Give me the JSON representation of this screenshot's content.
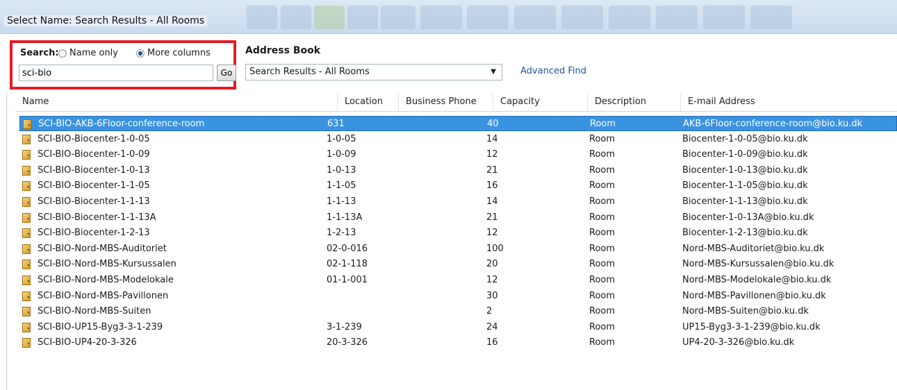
{
  "window": {
    "title": "Select Name: Search Results - All Rooms"
  },
  "search": {
    "label": "Search:",
    "option_name_only": "Name only",
    "option_more_columns": "More columns",
    "selected_option": "More columns",
    "query": "sci-bio",
    "go_label": "Go"
  },
  "address_book": {
    "label": "Address Book",
    "selected": "Search Results - All Rooms",
    "advanced_find": "Advanced Find"
  },
  "table": {
    "columns": [
      "Name",
      "Location",
      "Business Phone",
      "Capacity",
      "Description",
      "E-mail Address"
    ],
    "rows": [
      {
        "name": "SCI-BIO-AKB-6Floor-conference-room",
        "location": "631",
        "phone": "",
        "capacity": "40",
        "description": "Room",
        "email": "AKB-6Floor-conference-room@bio.ku.dk",
        "selected": true
      },
      {
        "name": "SCI-BIO-Biocenter-1-0-05",
        "location": "1-0-05",
        "phone": "",
        "capacity": "14",
        "description": "Room",
        "email": "Biocenter-1-0-05@bio.ku.dk"
      },
      {
        "name": "SCI-BIO-Biocenter-1-0-09",
        "location": "1-0-09",
        "phone": "",
        "capacity": "12",
        "description": "Room",
        "email": "Biocenter-1-0-09@bio.ku.dk"
      },
      {
        "name": "SCI-BIO-Biocenter-1-0-13",
        "location": "1-0-13",
        "phone": "",
        "capacity": "21",
        "description": "Room",
        "email": "Biocenter-1-0-13@bio.ku.dk"
      },
      {
        "name": "SCI-BIO-Biocenter-1-1-05",
        "location": "1-1-05",
        "phone": "",
        "capacity": "16",
        "description": "Room",
        "email": "Biocenter-1-1-05@bio.ku.dk"
      },
      {
        "name": "SCI-BIO-Biocenter-1-1-13",
        "location": "1-1-13",
        "phone": "",
        "capacity": "14",
        "description": "Room",
        "email": "Biocenter-1-1-13@bio.ku.dk"
      },
      {
        "name": "SCI-BIO-Biocenter-1-1-13A",
        "location": "1-1-13A",
        "phone": "",
        "capacity": "21",
        "description": "Room",
        "email": "Biocenter-1-0-13A@bio.ku.dk"
      },
      {
        "name": "SCI-BIO-Biocenter-1-2-13",
        "location": "1-2-13",
        "phone": "",
        "capacity": "12",
        "description": "Room",
        "email": "Biocenter-1-2-13@bio.ku.dk"
      },
      {
        "name": "SCI-BIO-Nord-MBS-Auditoriet",
        "location": "02-0-016",
        "phone": "",
        "capacity": "100",
        "description": "Room",
        "email": "Nord-MBS-Auditoriet@bio.ku.dk"
      },
      {
        "name": "SCI-BIO-Nord-MBS-Kursussalen",
        "location": "02-1-118",
        "phone": "",
        "capacity": "20",
        "description": "Room",
        "email": "Nord-MBS-Kursussalen@bio.ku.dk"
      },
      {
        "name": "SCI-BIO-Nord-MBS-Modelokale",
        "location": "01-1-001",
        "phone": "",
        "capacity": "12",
        "description": "Room",
        "email": "Nord-MBS-Modelokale@bio.ku.dk"
      },
      {
        "name": "SCI-BIO-Nord-MBS-Pavillonen",
        "location": "",
        "phone": "",
        "capacity": "30",
        "description": "Room",
        "email": "Nord-MBS-Pavillonen@bio.ku.dk"
      },
      {
        "name": "SCI-BIO-Nord-MBS-Suiten",
        "location": "",
        "phone": "",
        "capacity": "2",
        "description": "Room",
        "email": "Nord-MBS-Suiten@bio.ku.dk"
      },
      {
        "name": "SCI-BIO-UP15-Byg3-3-1-239",
        "location": "3-1-239",
        "phone": "",
        "capacity": "24",
        "description": "Room",
        "email": "UP15-Byg3-3-1-239@bio.ku.dk"
      },
      {
        "name": "SCI-BIO-UP4-20-3-326",
        "location": "20-3-326",
        "phone": "",
        "capacity": "16",
        "description": "Room",
        "email": "UP4-20-3-326@bio.ku.dk"
      }
    ]
  },
  "icons": {
    "row_icon": "room-resource-icon",
    "dropdown_icon": "chevron-down-icon"
  },
  "colors": {
    "selection": "#3a93e0",
    "highlight_border": "#e31b23",
    "link": "#1c56a8"
  }
}
